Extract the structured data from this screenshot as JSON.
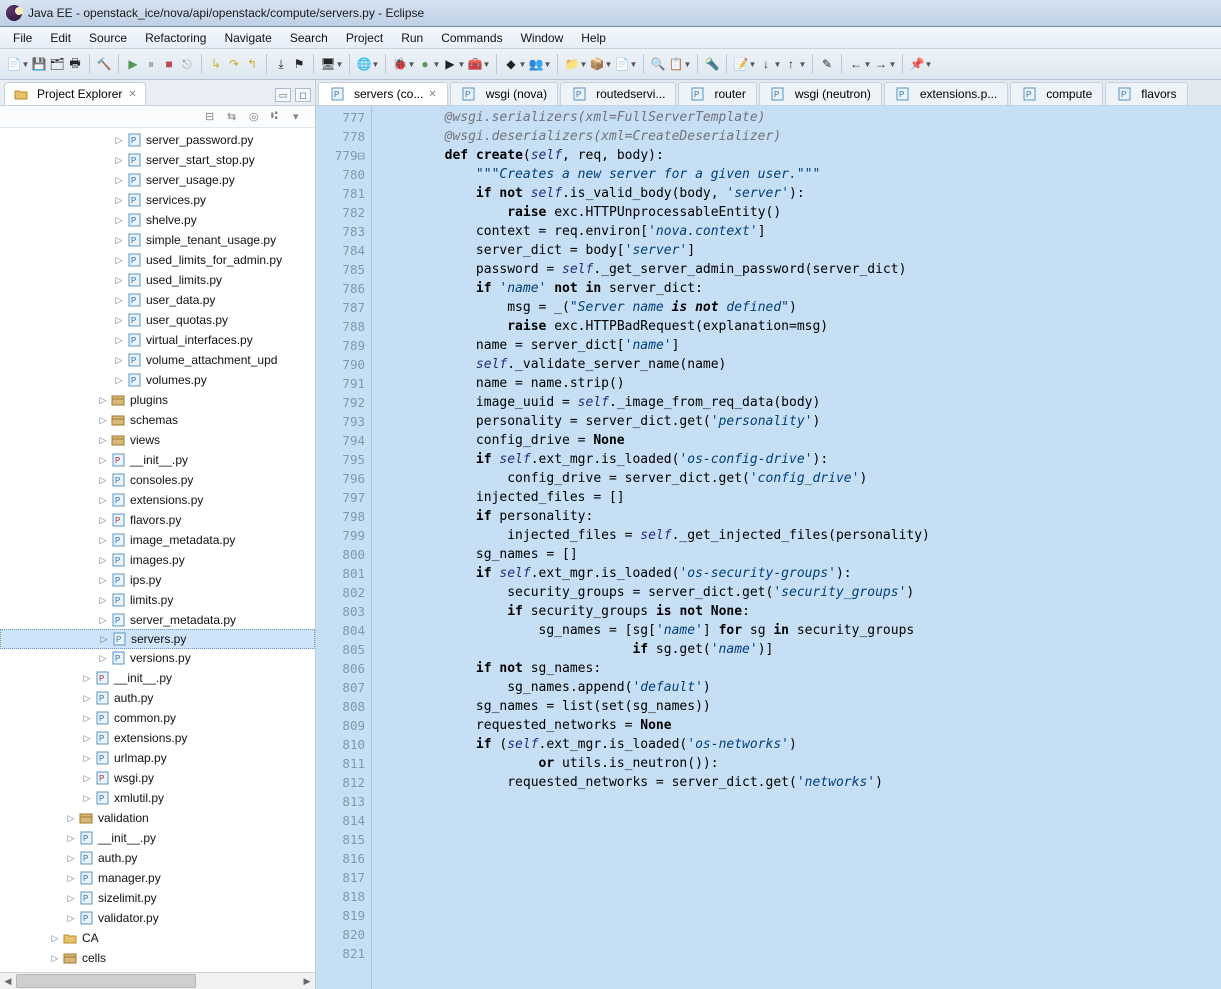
{
  "title": "Java EE - openstack_ice/nova/api/openstack/compute/servers.py - Eclipse",
  "menus": [
    "File",
    "Edit",
    "Source",
    "Refactoring",
    "Navigate",
    "Search",
    "Project",
    "Run",
    "Commands",
    "Window",
    "Help"
  ],
  "toolbar_icons": [
    {
      "name": "new-icon",
      "glyph": "📄",
      "dd": true
    },
    {
      "name": "save-icon",
      "glyph": "💾"
    },
    {
      "name": "save-all-icon",
      "glyph": "🗂"
    },
    {
      "name": "print-icon",
      "glyph": "🖶"
    },
    {
      "sep": true
    },
    {
      "name": "build-icon",
      "glyph": "🔨"
    },
    {
      "sep": true
    },
    {
      "name": "resume-icon",
      "glyph": "▶",
      "color": "#3a8b3a"
    },
    {
      "name": "pause-icon",
      "glyph": "⏸",
      "color": "#888"
    },
    {
      "name": "stop-icon",
      "glyph": "■",
      "color": "#b33"
    },
    {
      "name": "disconnect-icon",
      "glyph": "⎋",
      "color": "#888"
    },
    {
      "sep": true
    },
    {
      "name": "step-into-icon",
      "glyph": "↳",
      "color": "#c8a400"
    },
    {
      "name": "step-over-icon",
      "glyph": "↷",
      "color": "#c8a400"
    },
    {
      "name": "step-return-icon",
      "glyph": "↰",
      "color": "#c8a400"
    },
    {
      "sep": true
    },
    {
      "name": "drop-frame-icon",
      "glyph": "⤓"
    },
    {
      "name": "step-filters-icon",
      "glyph": "⚑"
    },
    {
      "sep": true
    },
    {
      "name": "server-icon",
      "glyph": "🖥",
      "dd": true
    },
    {
      "sep": true
    },
    {
      "name": "new-server-icon",
      "glyph": "🌐",
      "dd": true
    },
    {
      "sep": true
    },
    {
      "name": "debug-icon",
      "glyph": "🐞",
      "dd": true
    },
    {
      "name": "run-icon",
      "glyph": "●",
      "color": "#3a8b3a",
      "dd": true
    },
    {
      "name": "run-last-icon",
      "glyph": "▶",
      "dd": true
    },
    {
      "name": "ext-tools-icon",
      "glyph": "🧰",
      "dd": true
    },
    {
      "sep": true
    },
    {
      "name": "git-icon",
      "glyph": "◆",
      "dd": true
    },
    {
      "name": "team-icon",
      "glyph": "👥",
      "dd": true
    },
    {
      "sep": true
    },
    {
      "name": "new-project-icon",
      "glyph": "📁",
      "dd": true
    },
    {
      "name": "new-package-icon",
      "glyph": "📦",
      "dd": true
    },
    {
      "name": "new-file-icon",
      "glyph": "📄",
      "dd": true
    },
    {
      "sep": true
    },
    {
      "name": "open-type-icon",
      "glyph": "🔍"
    },
    {
      "name": "open-task-icon",
      "glyph": "📋",
      "dd": true
    },
    {
      "sep": true
    },
    {
      "name": "search-icon",
      "glyph": "🔦"
    },
    {
      "sep": true
    },
    {
      "name": "annotations-icon",
      "glyph": "📝",
      "dd": true
    },
    {
      "name": "next-annotation-icon",
      "glyph": "↓",
      "dd": true
    },
    {
      "name": "prev-annotation-icon",
      "glyph": "↑",
      "dd": true
    },
    {
      "sep": true
    },
    {
      "name": "last-edit-icon",
      "glyph": "✎"
    },
    {
      "sep": true
    },
    {
      "name": "back-icon",
      "glyph": "←",
      "dd": true
    },
    {
      "name": "forward-icon",
      "glyph": "→",
      "dd": true
    },
    {
      "sep": true
    },
    {
      "name": "pin-icon",
      "glyph": "📌",
      "dd": true
    }
  ],
  "explorer": {
    "title": "Project Explorer",
    "toolbar": [
      "link-with-editor-icon",
      "collapse-all-icon",
      "focus-task-icon",
      "view-menu-icon"
    ],
    "tree": [
      {
        "indent": 7,
        "icon": "py",
        "label": "server_password.py"
      },
      {
        "indent": 7,
        "icon": "py",
        "label": "server_start_stop.py"
      },
      {
        "indent": 7,
        "icon": "py",
        "label": "server_usage.py"
      },
      {
        "indent": 7,
        "icon": "py",
        "label": "services.py"
      },
      {
        "indent": 7,
        "icon": "py",
        "label": "shelve.py"
      },
      {
        "indent": 7,
        "icon": "py",
        "label": "simple_tenant_usage.py"
      },
      {
        "indent": 7,
        "icon": "py",
        "label": "used_limits_for_admin.py"
      },
      {
        "indent": 7,
        "icon": "py",
        "label": "used_limits.py"
      },
      {
        "indent": 7,
        "icon": "py",
        "label": "user_data.py"
      },
      {
        "indent": 7,
        "icon": "py",
        "label": "user_quotas.py"
      },
      {
        "indent": 7,
        "icon": "py",
        "label": "virtual_interfaces.py"
      },
      {
        "indent": 7,
        "icon": "py",
        "label": "volume_attachment_upd"
      },
      {
        "indent": 7,
        "icon": "py",
        "label": "volumes.py"
      },
      {
        "indent": 6,
        "icon": "pkg",
        "label": "plugins"
      },
      {
        "indent": 6,
        "icon": "pkg",
        "label": "schemas"
      },
      {
        "indent": 6,
        "icon": "pkg",
        "label": "views"
      },
      {
        "indent": 6,
        "icon": "pyi",
        "label": "__init__.py"
      },
      {
        "indent": 6,
        "icon": "py",
        "label": "consoles.py"
      },
      {
        "indent": 6,
        "icon": "py",
        "label": "extensions.py"
      },
      {
        "indent": 6,
        "icon": "pyi",
        "label": "flavors.py"
      },
      {
        "indent": 6,
        "icon": "py",
        "label": "image_metadata.py"
      },
      {
        "indent": 6,
        "icon": "py",
        "label": "images.py"
      },
      {
        "indent": 6,
        "icon": "py",
        "label": "ips.py"
      },
      {
        "indent": 6,
        "icon": "py",
        "label": "limits.py"
      },
      {
        "indent": 6,
        "icon": "py",
        "label": "server_metadata.py"
      },
      {
        "indent": 6,
        "icon": "py",
        "label": "servers.py",
        "selected": true
      },
      {
        "indent": 6,
        "icon": "py",
        "label": "versions.py"
      },
      {
        "indent": 5,
        "icon": "pyi",
        "label": "__init__.py"
      },
      {
        "indent": 5,
        "icon": "py",
        "label": "auth.py"
      },
      {
        "indent": 5,
        "icon": "py",
        "label": "common.py"
      },
      {
        "indent": 5,
        "icon": "py",
        "label": "extensions.py"
      },
      {
        "indent": 5,
        "icon": "py",
        "label": "urlmap.py"
      },
      {
        "indent": 5,
        "icon": "pyi",
        "label": "wsgi.py"
      },
      {
        "indent": 5,
        "icon": "py",
        "label": "xmlutil.py"
      },
      {
        "indent": 4,
        "icon": "pkg",
        "label": "validation"
      },
      {
        "indent": 4,
        "icon": "py",
        "label": "__init__.py"
      },
      {
        "indent": 4,
        "icon": "py",
        "label": "auth.py"
      },
      {
        "indent": 4,
        "icon": "py",
        "label": "manager.py"
      },
      {
        "indent": 4,
        "icon": "py",
        "label": "sizelimit.py"
      },
      {
        "indent": 4,
        "icon": "py",
        "label": "validator.py"
      },
      {
        "indent": 3,
        "icon": "folder",
        "label": "CA"
      },
      {
        "indent": 3,
        "icon": "pkg",
        "label": "cells"
      }
    ]
  },
  "editor_tabs": [
    {
      "label": "servers (co...",
      "active": true,
      "close": true
    },
    {
      "label": "wsgi (nova)"
    },
    {
      "label": "routedservi..."
    },
    {
      "label": "router"
    },
    {
      "label": "wsgi (neutron)"
    },
    {
      "label": "extensions.p..."
    },
    {
      "label": "compute"
    },
    {
      "label": "flavors"
    }
  ],
  "code": {
    "first_line": 777,
    "fold_line": 779,
    "lines": [
      "        @wsgi.serializers(xml=FullServerTemplate)",
      "        @wsgi.deserializers(xml=CreateDeserializer)",
      "        def create(self, req, body):",
      "            \"\"\"Creates a new server for a given user.\"\"\"",
      "            if not self.is_valid_body(body, 'server'):",
      "                raise exc.HTTPUnprocessableEntity()",
      "",
      "            context = req.environ['nova.context']",
      "            server_dict = body['server']",
      "            password = self._get_server_admin_password(server_dict)",
      "",
      "            if 'name' not in server_dict:",
      "                msg = _(\"Server name is not defined\")",
      "                raise exc.HTTPBadRequest(explanation=msg)",
      "",
      "            name = server_dict['name']",
      "            self._validate_server_name(name)",
      "            name = name.strip()",
      "",
      "            image_uuid = self._image_from_req_data(body)",
      "",
      "            personality = server_dict.get('personality')",
      "            config_drive = None",
      "            if self.ext_mgr.is_loaded('os-config-drive'):",
      "                config_drive = server_dict.get('config_drive')",
      "",
      "            injected_files = []",
      "            if personality:",
      "                injected_files = self._get_injected_files(personality)",
      "",
      "            sg_names = []",
      "            if self.ext_mgr.is_loaded('os-security-groups'):",
      "                security_groups = server_dict.get('security_groups')",
      "                if security_groups is not None:",
      "                    sg_names = [sg['name'] for sg in security_groups",
      "                                if sg.get('name')]",
      "            if not sg_names:",
      "                sg_names.append('default')",
      "",
      "            sg_names = list(set(sg_names))",
      "",
      "            requested_networks = None",
      "            if (self.ext_mgr.is_loaded('os-networks')",
      "                    or utils.is_neutron()):",
      "                requested_networks = server_dict.get('networks')"
    ]
  }
}
